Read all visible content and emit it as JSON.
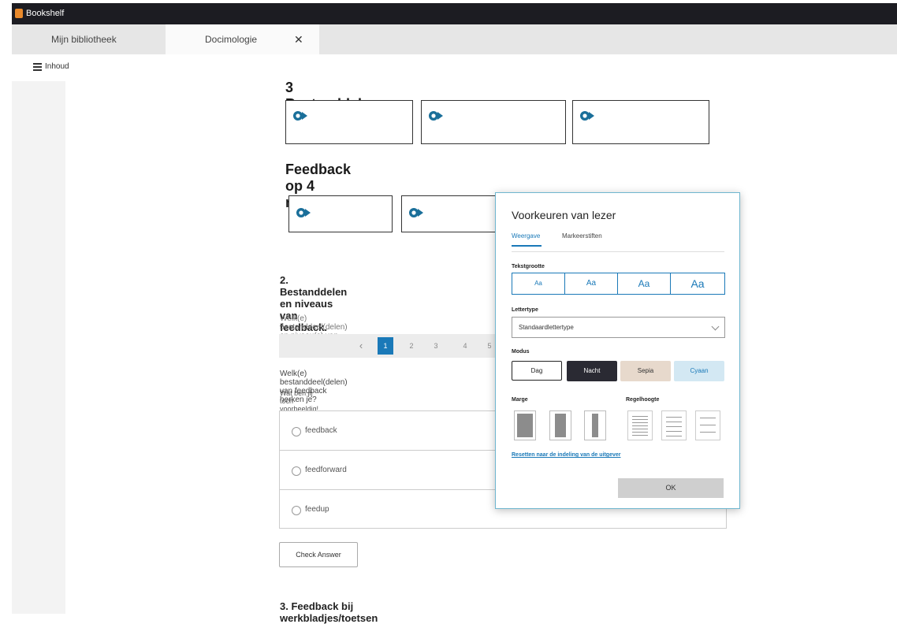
{
  "window": {
    "app_name": "Bookshelf"
  },
  "tabs": [
    {
      "label": "Mijn bibliotheek"
    },
    {
      "label": "Docimologie",
      "close": "✕"
    }
  ],
  "toolbar": {
    "menu_label": "Inhoud"
  },
  "content": {
    "heading_1": "3 Bestanddelen van feedback",
    "heading_2": "Feedback op 4 niveaus",
    "section_2_title": "2. Bestanddelen en niveaus van feedback.",
    "section_2_intro": "Welk(e) bestanddeel(delen) en niveau(s) van feedback h",
    "pager": {
      "prev": "‹",
      "pages": [
        "1",
        "2",
        "3",
        "4",
        "5"
      ],
      "active": "1"
    },
    "question": "Welk(e) bestanddeel(delen) van feedback herken je?",
    "hint": "Wat ben jij toch voorbeeldig!",
    "options": [
      "feedback",
      "feedforward",
      "feedup"
    ],
    "check_button": "Check Answer",
    "section_3_title": "3. Feedback bij werkbladjes/toetsen"
  },
  "dialog": {
    "title": "Voorkeuren van lezer",
    "tabs": [
      "Weergave",
      "Markeerstiften"
    ],
    "font_size_label": "Tekstgrootte",
    "font_sizes": [
      "Aa",
      "Aa",
      "Aa",
      "Aa"
    ],
    "font_label": "Lettertype",
    "font_value": "Standaardlettertype",
    "mode_label": "Modus",
    "modes": [
      "Dag",
      "Nacht",
      "Sepia",
      "Cyaan"
    ],
    "margin_label": "Marge",
    "line_height_label": "Regelhoogte",
    "reset_link": "Resetten naar de indeling van de uitgever",
    "ok_button": "OK"
  },
  "colors": {
    "accent": "#1a79b8",
    "pin": "#1a6f9a",
    "night": "#2a2a33",
    "sepia": "#e7d9cc",
    "cyan": "#d3e8f3"
  },
  "icons": {
    "hotspot": "hotspot-pin-icon",
    "menu": "hamburger-menu-icon",
    "app": "bookshelf-app-icon"
  }
}
